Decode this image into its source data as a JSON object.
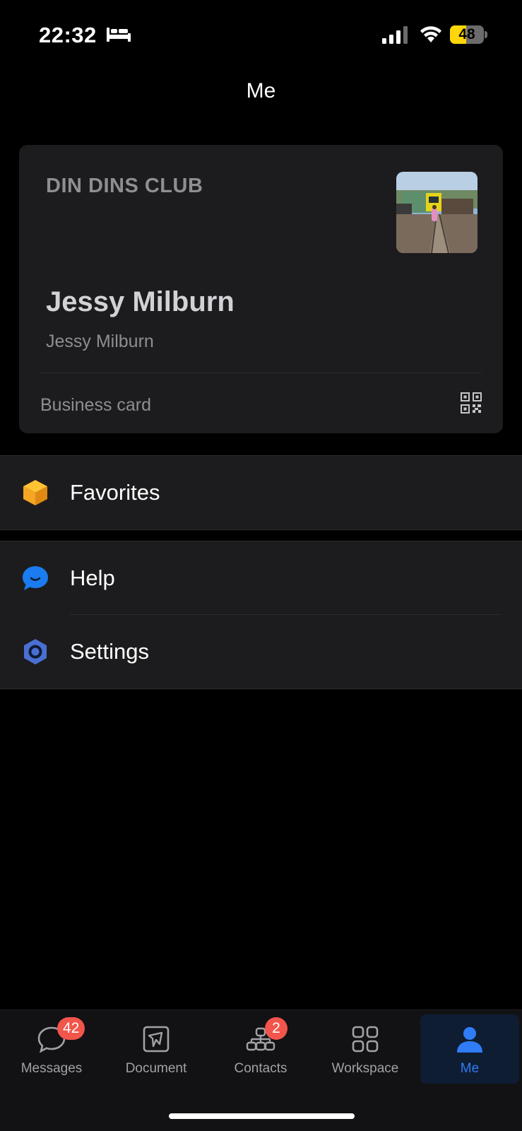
{
  "status_bar": {
    "time": "22:32",
    "battery_level": "48",
    "battery_fraction": 0.48,
    "icons": [
      "bed-icon",
      "signal-icon",
      "wifi-icon",
      "battery-icon"
    ]
  },
  "header": {
    "title": "Me"
  },
  "card": {
    "org_name": "DIN DINS CLUB",
    "name": "Jessy Milburn",
    "subname": "Jessy Milburn",
    "footer_label": "Business card",
    "footer_icon": "qr-code-icon"
  },
  "sections": [
    {
      "items": [
        {
          "label": "Favorites",
          "icon": "favorites-box-icon",
          "icon_color": "#f5a623"
        }
      ]
    },
    {
      "items": [
        {
          "label": "Help",
          "icon": "help-chat-icon",
          "icon_color": "#1a7cf0"
        },
        {
          "label": "Settings",
          "icon": "settings-hexagon-icon",
          "icon_color": "#4a6fd3"
        }
      ]
    }
  ],
  "tab_bar": {
    "tabs": [
      {
        "label": "Messages",
        "icon": "messages-icon",
        "badge": "42"
      },
      {
        "label": "Document",
        "icon": "document-icon",
        "badge": ""
      },
      {
        "label": "Contacts",
        "icon": "contacts-icon",
        "badge": "2"
      },
      {
        "label": "Workspace",
        "icon": "workspace-icon",
        "badge": ""
      },
      {
        "label": "Me",
        "icon": "me-person-icon",
        "badge": "",
        "active": true
      }
    ]
  },
  "colors": {
    "accent": "#2f7cf6",
    "badge": "#f2554b",
    "card_background": "#1c1c1e",
    "battery_fill": "#ffd60a"
  }
}
